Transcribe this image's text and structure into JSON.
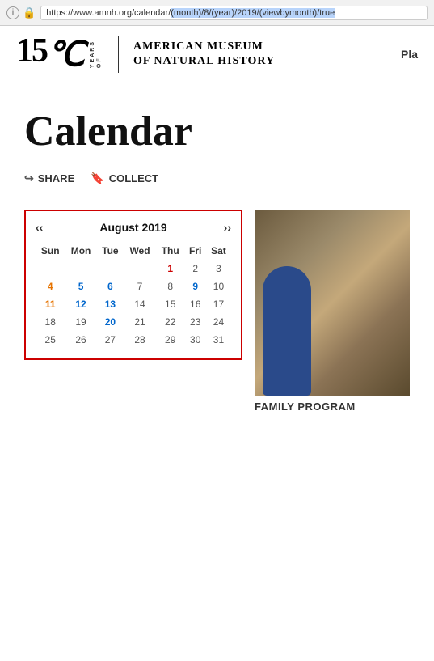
{
  "browser": {
    "url_plain": "https://www.amnh.org/calendar/",
    "url_highlighted": "(month)/8/(year)/2019/(viewbymonth)/true",
    "info_icon": "i",
    "lock_icon": "🔒"
  },
  "header": {
    "logo_number": "15",
    "logo_c": "©",
    "logo_years_line1": "YEARS",
    "logo_of": "OF",
    "logo_text_line1": "American Museum",
    "logo_text_line2": "of Natural History",
    "nav_label": "Pla"
  },
  "page": {
    "title": "Calendar",
    "share_label": "SHARE",
    "collect_label": "COLLECT"
  },
  "calendar": {
    "prev": "‹‹",
    "next": "››",
    "month_year": "August 2019",
    "days": [
      "Sun",
      "Mon",
      "Tue",
      "Wed",
      "Thu",
      "Fri",
      "Sat"
    ],
    "weeks": [
      [
        null,
        null,
        null,
        null,
        null,
        {
          "n": 1,
          "c": "red"
        },
        {
          "n": 2,
          "c": "normal"
        },
        {
          "n": 3,
          "c": "normal"
        }
      ],
      [
        {
          "n": 4,
          "c": "orange"
        },
        {
          "n": 5,
          "c": "blue"
        },
        {
          "n": 6,
          "c": "blue"
        },
        {
          "n": 7,
          "c": "normal"
        },
        {
          "n": 8,
          "c": "normal"
        },
        {
          "n": 9,
          "c": "blue"
        },
        {
          "n": 10,
          "c": "normal"
        }
      ],
      [
        {
          "n": 11,
          "c": "orange"
        },
        {
          "n": 12,
          "c": "blue"
        },
        {
          "n": 13,
          "c": "blue"
        },
        {
          "n": 14,
          "c": "normal"
        },
        {
          "n": 15,
          "c": "normal"
        },
        {
          "n": 16,
          "c": "normal"
        },
        {
          "n": 17,
          "c": "normal"
        }
      ],
      [
        {
          "n": 18,
          "c": "normal"
        },
        {
          "n": 19,
          "c": "normal"
        },
        {
          "n": 20,
          "c": "blue"
        },
        {
          "n": 21,
          "c": "normal"
        },
        {
          "n": 22,
          "c": "normal"
        },
        {
          "n": 23,
          "c": "normal"
        },
        {
          "n": 24,
          "c": "normal"
        }
      ],
      [
        {
          "n": 25,
          "c": "normal"
        },
        {
          "n": 26,
          "c": "normal"
        },
        {
          "n": 27,
          "c": "normal"
        },
        {
          "n": 28,
          "c": "normal"
        },
        {
          "n": 29,
          "c": "normal"
        },
        {
          "n": 30,
          "c": "normal"
        },
        {
          "n": 31,
          "c": "normal"
        }
      ]
    ]
  },
  "sidebar": {
    "image_alt": "Family program photo",
    "family_program_label": "FAMILY PROGRAM"
  }
}
